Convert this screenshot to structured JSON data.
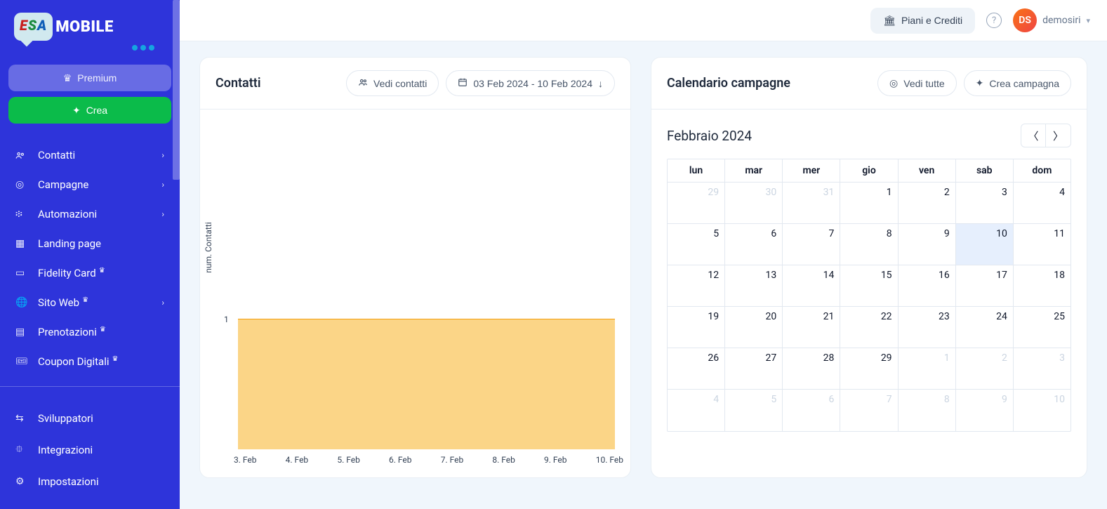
{
  "brand": {
    "esa": "ESA",
    "mobile": "MOBILE"
  },
  "sidebar": {
    "premium_label": "Premium",
    "crea_label": "Crea",
    "items": [
      {
        "label": "Contatti",
        "icon": "users",
        "expandable": true
      },
      {
        "label": "Campagne",
        "icon": "target",
        "expandable": true
      },
      {
        "label": "Automazioni",
        "icon": "flow",
        "expandable": true
      },
      {
        "label": "Landing page",
        "icon": "grid",
        "expandable": false
      },
      {
        "label": "Fidelity Card",
        "icon": "card",
        "expandable": false,
        "crown": true
      },
      {
        "label": "Sito Web",
        "icon": "globe",
        "expandable": true,
        "crown": true
      },
      {
        "label": "Prenotazioni",
        "icon": "calendar",
        "expandable": false,
        "crown": true
      },
      {
        "label": "Coupon Digitali",
        "icon": "ticket",
        "expandable": false,
        "crown": true
      }
    ],
    "footer": [
      {
        "label": "Sviluppatori",
        "icon": "arrows"
      },
      {
        "label": "Integrazioni",
        "icon": "puzzle"
      },
      {
        "label": "Impostazioni",
        "icon": "gear"
      }
    ]
  },
  "topbar": {
    "plans_label": "Piani e Crediti",
    "help": "?",
    "user_initials": "DS",
    "username": "demosiri"
  },
  "contatti": {
    "title": "Contatti",
    "view_label": "Vedi contatti",
    "date_range": "03 Feb 2024 - 10 Feb 2024"
  },
  "calendar": {
    "title": "Calendario campagne",
    "view_all": "Vedi tutte",
    "create": "Crea campagna",
    "month": "Febbraio 2024",
    "daynames": [
      "lun",
      "mar",
      "mer",
      "gio",
      "ven",
      "sab",
      "dom"
    ],
    "weeks": [
      [
        {
          "d": "29",
          "m": true
        },
        {
          "d": "30",
          "m": true
        },
        {
          "d": "31",
          "m": true
        },
        {
          "d": "1"
        },
        {
          "d": "2"
        },
        {
          "d": "3"
        },
        {
          "d": "4"
        }
      ],
      [
        {
          "d": "5"
        },
        {
          "d": "6"
        },
        {
          "d": "7"
        },
        {
          "d": "8"
        },
        {
          "d": "9"
        },
        {
          "d": "10",
          "today": true
        },
        {
          "d": "11"
        }
      ],
      [
        {
          "d": "12"
        },
        {
          "d": "13"
        },
        {
          "d": "14"
        },
        {
          "d": "15"
        },
        {
          "d": "16"
        },
        {
          "d": "17"
        },
        {
          "d": "18"
        }
      ],
      [
        {
          "d": "19"
        },
        {
          "d": "20"
        },
        {
          "d": "21"
        },
        {
          "d": "22"
        },
        {
          "d": "23"
        },
        {
          "d": "24"
        },
        {
          "d": "25"
        }
      ],
      [
        {
          "d": "26"
        },
        {
          "d": "27"
        },
        {
          "d": "28"
        },
        {
          "d": "29"
        },
        {
          "d": "1",
          "m": true
        },
        {
          "d": "2",
          "m": true
        },
        {
          "d": "3",
          "m": true
        }
      ],
      [
        {
          "d": "4",
          "m": true
        },
        {
          "d": "5",
          "m": true
        },
        {
          "d": "6",
          "m": true
        },
        {
          "d": "7",
          "m": true
        },
        {
          "d": "8",
          "m": true
        },
        {
          "d": "9",
          "m": true
        },
        {
          "d": "10",
          "m": true
        }
      ]
    ]
  },
  "chart_data": {
    "type": "area",
    "title": "Contatti",
    "ylabel": "num. Contatti",
    "xlabel": "",
    "ylim": [
      0,
      2.5
    ],
    "y_ticks": [
      1
    ],
    "categories": [
      "3. Feb",
      "4. Feb",
      "5. Feb",
      "6. Feb",
      "7. Feb",
      "8. Feb",
      "9. Feb",
      "10. Feb"
    ],
    "values": [
      1,
      1,
      1,
      1,
      1,
      1,
      1,
      1
    ]
  }
}
